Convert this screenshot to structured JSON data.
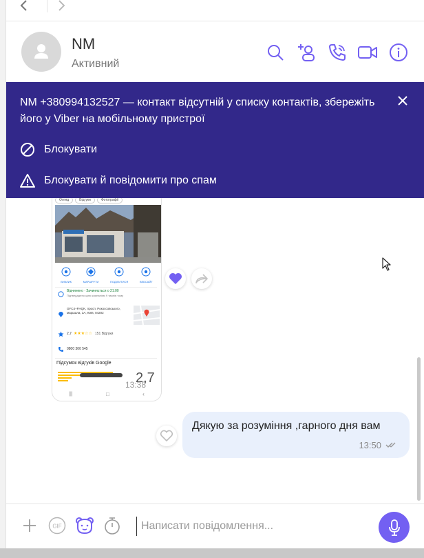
{
  "nav": {
    "back_icon": "chevron-left-icon",
    "forward_icon": "chevron-right-icon"
  },
  "header": {
    "name": "NM",
    "status": "Активний",
    "icons": [
      "search-icon",
      "add-participant-icon",
      "phone-icon",
      "video-icon",
      "info-icon"
    ]
  },
  "banner": {
    "message": "NM +380994132527 — контакт відсутній у списку контактів, збережіть його у Viber на мобільному пристрої",
    "block_label": "Блокувати",
    "block_report_label": "Блокувати й повідомити про спам"
  },
  "image_message": {
    "tabs": [
      "Огляд",
      "Відгуки",
      "Фотографії"
    ],
    "actions": [
      "ВИКЛИК",
      "МАРШРУТИ",
      "ПОДІЛИТИСЯ",
      "ВЕБСАЙТ"
    ],
    "hours": "Відчинено · Зачиняється о 21:00",
    "hours_note": "Підтверджено цією компанією 9 тижнів тому",
    "address": "GFC4+FHQK, просп. Рокоссовського, маршала, 3А, Київ, 04202",
    "rating": "2,7",
    "reviews_count": "151 Відгуки",
    "phone": "0800 300 545",
    "reviews_title": "Підсумок відгуків Google",
    "rating_big": "2,7",
    "time": "13:38"
  },
  "outgoing_message": {
    "text": "Дякую за розуміння ,гарного дня вам",
    "time": "13:50"
  },
  "composer": {
    "placeholder": "Написати повідомлення...",
    "gif_label": "GIF"
  },
  "colors": {
    "accent": "#7360f2",
    "banner_bg": "#32288a",
    "bubble_out": "#e9f0fc"
  }
}
